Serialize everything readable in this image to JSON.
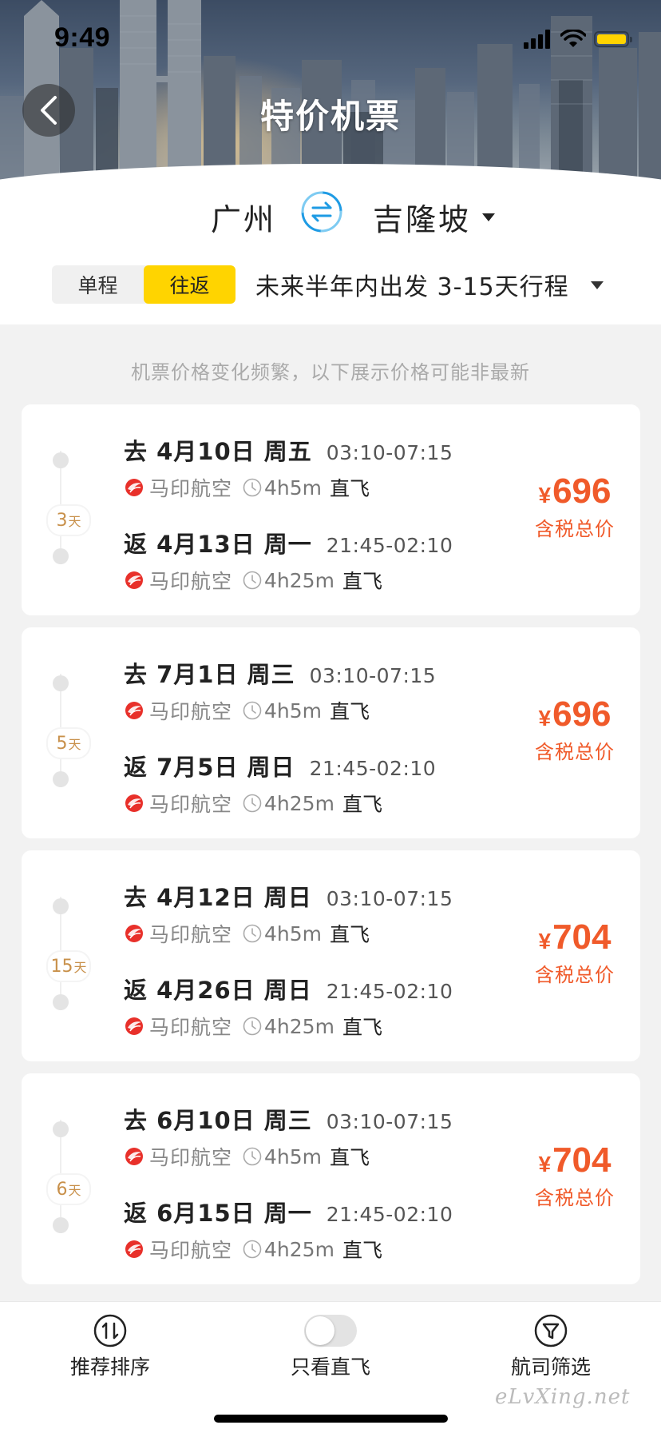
{
  "status_bar": {
    "time": "9:49",
    "battery_color": "#ffd400"
  },
  "header": {
    "title": "特价机票",
    "back_icon": "chevron-left-icon"
  },
  "route": {
    "from": "广州",
    "to": "吉隆坡",
    "swap_icon": "swap-icon"
  },
  "trip": {
    "options": [
      "单程",
      "往返"
    ],
    "selected": "往返",
    "date_range": "未来半年内出发 3-15天行程"
  },
  "notice": "机票价格变化频繁，以下展示价格可能非最新",
  "colors": {
    "accent": "#ffd400",
    "price": "#f05a2a",
    "days": "#c8904a",
    "airline": "#e8302a"
  },
  "cards": [
    {
      "days": "3",
      "days_unit": "天",
      "out": {
        "date": "去 4月10日 周五",
        "time": "03:10-07:15",
        "airline": "马印航空",
        "duration": "4h5m",
        "direct": "直飞"
      },
      "ret": {
        "date": "返 4月13日 周一",
        "time": "21:45-02:10",
        "airline": "马印航空",
        "duration": "4h25m",
        "direct": "直飞"
      },
      "currency": "¥",
      "price": "696",
      "price_label": "含税总价"
    },
    {
      "days": "5",
      "days_unit": "天",
      "out": {
        "date": "去 7月1日 周三",
        "time": "03:10-07:15",
        "airline": "马印航空",
        "duration": "4h5m",
        "direct": "直飞"
      },
      "ret": {
        "date": "返 7月5日 周日",
        "time": "21:45-02:10",
        "airline": "马印航空",
        "duration": "4h25m",
        "direct": "直飞"
      },
      "currency": "¥",
      "price": "696",
      "price_label": "含税总价"
    },
    {
      "days": "15",
      "days_unit": "天",
      "out": {
        "date": "去 4月12日 周日",
        "time": "03:10-07:15",
        "airline": "马印航空",
        "duration": "4h5m",
        "direct": "直飞"
      },
      "ret": {
        "date": "返 4月26日 周日",
        "time": "21:45-02:10",
        "airline": "马印航空",
        "duration": "4h25m",
        "direct": "直飞"
      },
      "currency": "¥",
      "price": "704",
      "price_label": "含税总价"
    },
    {
      "days": "6",
      "days_unit": "天",
      "out": {
        "date": "去 6月10日 周三",
        "time": "03:10-07:15",
        "airline": "马印航空",
        "duration": "4h5m",
        "direct": "直飞"
      },
      "ret": {
        "date": "返 6月15日 周一",
        "time": "21:45-02:10",
        "airline": "马印航空",
        "duration": "4h25m",
        "direct": "直飞"
      },
      "currency": "¥",
      "price": "704",
      "price_label": "含税总价"
    }
  ],
  "bottom_bar": {
    "sort_label": "推荐排序",
    "sort_icon": "sort-icon",
    "direct_label": "只看直飞",
    "direct_on": false,
    "filter_label": "航司筛选",
    "filter_icon": "filter-icon"
  },
  "watermark": "eLvXing.net"
}
